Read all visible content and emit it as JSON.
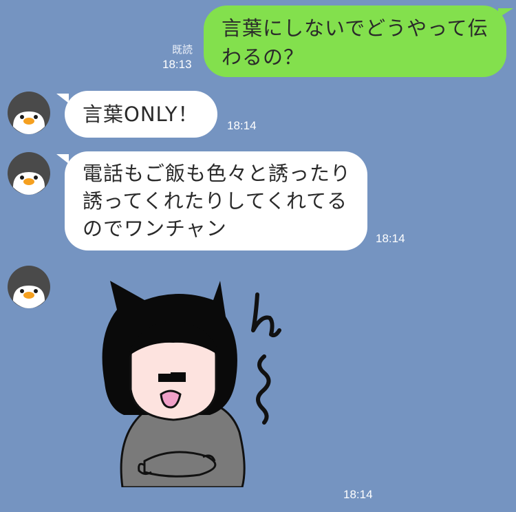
{
  "messages": [
    {
      "side": "outgoing",
      "lines": [
        "言葉にしないでどうやって伝",
        "わるの？"
      ],
      "read_label": "既読",
      "time": "18:13"
    },
    {
      "side": "incoming",
      "lines": [
        "言葉ONLY！"
      ],
      "time": "18:14"
    },
    {
      "side": "incoming",
      "lines": [
        "電話もご飯も色々と誘ったり",
        "誘ってくれたりしてくれてる",
        "のでワンチャン"
      ],
      "time": "18:14"
    },
    {
      "side": "incoming",
      "type": "sticker",
      "sticker_text": "ん〜",
      "time": "18:14"
    }
  ],
  "colors": {
    "background": "#7594c1",
    "outgoing_bubble": "#83e04d",
    "incoming_bubble": "#ffffff",
    "meta_text": "#ffffff"
  },
  "icons": {
    "avatar": "penguin-avatar-icon",
    "sticker": "sulking-girl-sticker"
  }
}
